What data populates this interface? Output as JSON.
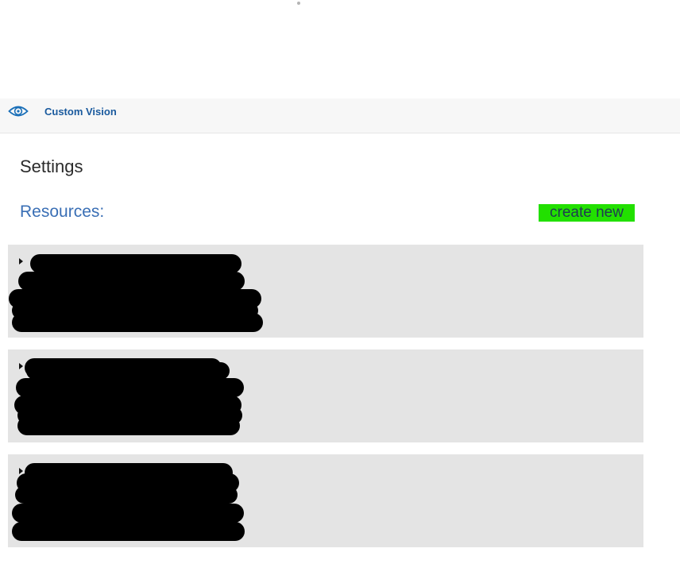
{
  "app": {
    "name": "Custom Vision",
    "logo_icon": "eye-icon"
  },
  "page": {
    "title": "Settings"
  },
  "resources": {
    "header": "Resources:",
    "create_new_label": "create new",
    "create_new_highlight": "#22e000",
    "expand_icon": "caret-right-icon",
    "items": [
      {
        "state": "collapsed",
        "content": "redacted"
      },
      {
        "state": "collapsed",
        "content": "redacted"
      },
      {
        "state": "collapsed",
        "content": "redacted"
      }
    ]
  },
  "colors": {
    "app_name": "#1a5a9e",
    "section_header": "#3a6fb5",
    "panel_background": "#e4e4e4",
    "app_bar_background": "#f7f7f7"
  }
}
